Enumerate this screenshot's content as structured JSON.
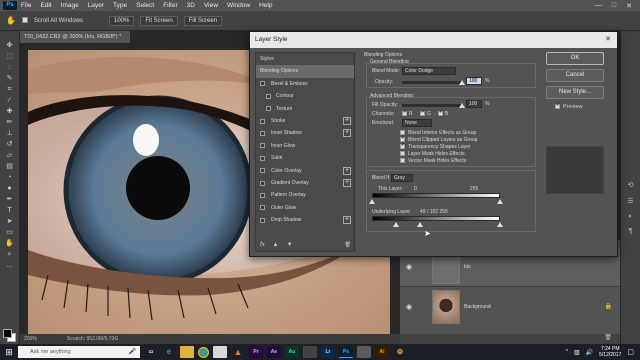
{
  "app": {
    "logo": "Ps",
    "menu": [
      "File",
      "Edit",
      "Image",
      "Layer",
      "Type",
      "Select",
      "Filter",
      "3D",
      "View",
      "Window",
      "Help"
    ],
    "window_controls": [
      "—",
      "□",
      "✕"
    ]
  },
  "options_bar": {
    "scroll_all_windows": "Scroll All Windows",
    "zoom_value": "100%",
    "fit_screen": "Fit Screen",
    "fill_screen": "Fill Screen"
  },
  "document": {
    "tab_title": "TDI_0432.CR2 @ 200% (Iris, RGB/8*) *",
    "zoom": "200%",
    "scratch": "Scratch: 952.0M/5.73G"
  },
  "dialog": {
    "title": "Layer Style",
    "close": "✕",
    "styles_header": "Styles",
    "style_items": [
      {
        "label": "Blending Options",
        "kind": "head",
        "selected": true
      },
      {
        "label": "Bevel & Emboss",
        "kind": "cb"
      },
      {
        "label": "Contour",
        "kind": "sub"
      },
      {
        "label": "Texture",
        "kind": "sub"
      },
      {
        "label": "Stroke",
        "kind": "cb",
        "plus": true
      },
      {
        "label": "Inner Shadow",
        "kind": "cb",
        "plus": true
      },
      {
        "label": "Inner Glow",
        "kind": "cb"
      },
      {
        "label": "Satin",
        "kind": "cb"
      },
      {
        "label": "Color Overlay",
        "kind": "cb",
        "plus": true
      },
      {
        "label": "Gradient Overlay",
        "kind": "cb",
        "plus": true
      },
      {
        "label": "Pattern Overlay",
        "kind": "cb"
      },
      {
        "label": "Outer Glow",
        "kind": "cb"
      },
      {
        "label": "Drop Shadow",
        "kind": "cb",
        "plus": true
      }
    ],
    "fx_icons": [
      "fx",
      "▲",
      "▼",
      "🗑"
    ],
    "blending": {
      "section_title": "Blending Options",
      "general_title": "General Blending",
      "blend_mode_label": "Blend Mode:",
      "blend_mode_value": "Color Dodge",
      "opacity_label": "Opacity:",
      "opacity_value": "100",
      "percent": "%",
      "advanced_title": "Advanced Blending",
      "fill_opacity_label": "Fill Opacity:",
      "fill_opacity_value": "100",
      "channels_label": "Channels:",
      "channel_r": "R",
      "channel_g": "G",
      "channel_b": "B",
      "knockout_label": "Knockout:",
      "knockout_value": "None",
      "checks": [
        {
          "label": "Blend Interior Effects as Group",
          "on": false
        },
        {
          "label": "Blend Clipped Layers as Group",
          "on": true
        },
        {
          "label": "Transparency Shapes Layer",
          "on": true
        },
        {
          "label": "Layer Mask Hides Effects",
          "on": false
        },
        {
          "label": "Vector Mask Hides Effects",
          "on": false
        }
      ],
      "blend_if_label": "Blend If:",
      "blend_if_value": "Gray",
      "this_layer_label": "This Layer:",
      "this_layer_low": "0",
      "this_layer_high": "255",
      "underlying_label": "Underlying Layer:",
      "underlying_values": "49 / 102   255"
    },
    "buttons": {
      "ok": "OK",
      "cancel": "Cancel",
      "new_style": "New Style...",
      "preview": "Preview"
    }
  },
  "layers": {
    "items": [
      {
        "name": "Iris"
      },
      {
        "name": "Background"
      }
    ]
  },
  "taskbar": {
    "search_placeholder": "Ask me anything",
    "apps": [
      {
        "label": "e",
        "color": "#3a86d6",
        "bg": "#1c1f26"
      },
      {
        "label": "",
        "color": "#fff",
        "bg": "#e0b33a"
      },
      {
        "label": "",
        "color": "#fff",
        "bg": "#2c8a3a"
      },
      {
        "label": "",
        "color": "#fff",
        "bg": "#d8d8d8"
      },
      {
        "label": "",
        "color": "#fff",
        "bg": "#e27a1e"
      },
      {
        "label": "Pr",
        "color": "#e7a6ff",
        "bg": "#2a0a3b"
      },
      {
        "label": "Ae",
        "color": "#d6a3ff",
        "bg": "#1f0b3a"
      },
      {
        "label": "Au",
        "color": "#40e0b0",
        "bg": "#073426"
      },
      {
        "label": "Lr",
        "color": "#9fd2ff",
        "bg": "#0d2a44"
      },
      {
        "label": "Ps",
        "color": "#31a8ff",
        "bg": "#0b1f33"
      },
      {
        "label": "Ai",
        "color": "#ff9a00",
        "bg": "#331c00"
      },
      {
        "label": "",
        "color": "#fff",
        "bg": "#444"
      },
      {
        "label": "",
        "color": "#fff",
        "bg": "#5a5a5a"
      }
    ],
    "time": "7:24 PM",
    "date": "5/12/2017"
  }
}
